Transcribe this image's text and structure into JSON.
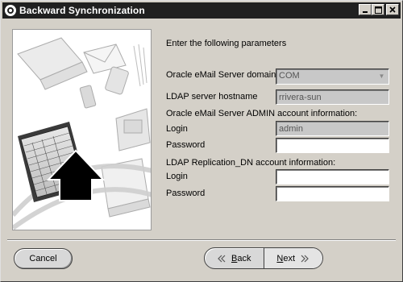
{
  "window": {
    "title": "Backward Synchronization"
  },
  "titlebar_buttons": {
    "minimize": "_",
    "maximize": "□",
    "close": "✕"
  },
  "form": {
    "intro": "Enter the following parameters",
    "domain_label": "Oracle eMail Server domain",
    "domain_value": "COM",
    "ldap_host_label": "LDAP server hostname",
    "ldap_host_value": "rrivera-sun",
    "admin_section": "Oracle eMail Server ADMIN account information:",
    "admin_login_label": "Login",
    "admin_login_value": "admin",
    "admin_password_label": "Password",
    "admin_password_value": "",
    "repl_section": "LDAP Replication_DN account information:",
    "repl_login_label": "Login",
    "repl_login_value": "",
    "repl_password_label": "Password",
    "repl_password_value": ""
  },
  "buttons": {
    "cancel": "Cancel",
    "back_prefix": "",
    "back_mnemonic": "B",
    "back_rest": "ack",
    "next_mnemonic": "N",
    "next_rest": "ext"
  },
  "icons": {
    "app": "oracle-ring-icon",
    "back": "chevron-left-double-icon",
    "next": "chevron-right-double-icon",
    "illustration": "office-devices-sync-illustration"
  }
}
